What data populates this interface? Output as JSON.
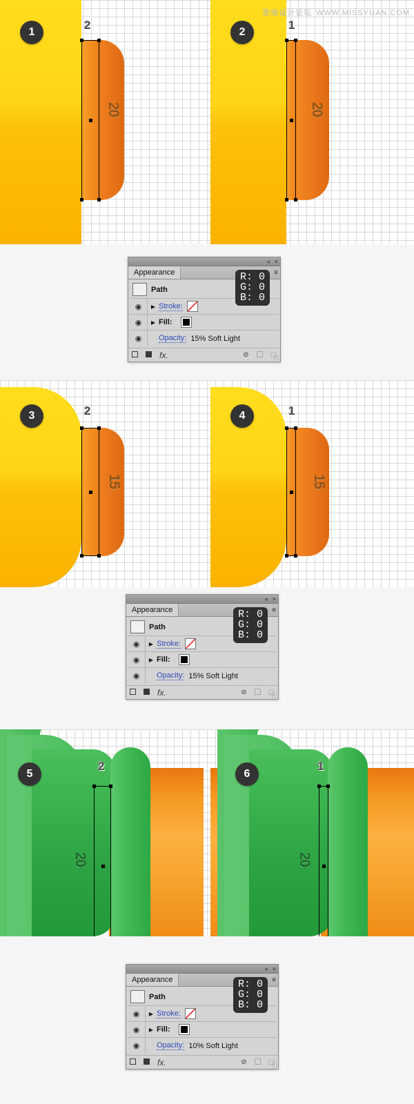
{
  "watermark": {
    "chinese": "思缘设计论坛",
    "url": "WWW.MISSYUAN.COM"
  },
  "steps": [
    {
      "badge": "1",
      "dimension": "2",
      "size": "20"
    },
    {
      "badge": "2",
      "dimension": "1",
      "size": "20"
    },
    {
      "badge": "3",
      "dimension": "2",
      "size": "15"
    },
    {
      "badge": "4",
      "dimension": "1",
      "size": "15"
    },
    {
      "badge": "5",
      "dimension": "2",
      "size": "20"
    },
    {
      "badge": "6",
      "dimension": "1",
      "size": "20"
    }
  ],
  "panels": [
    {
      "title": "Appearance",
      "collapse_icon": "«",
      "close_icon": "×",
      "menu_icon": "≡",
      "object_label": "Path",
      "stroke_label": "Stroke:",
      "fill_label": "Fill:",
      "opacity_label": "Opacity:",
      "opacity_value": "15% Soft Light",
      "tooltip": {
        "r": "R: 0",
        "g": "G: 0",
        "b": "B: 0"
      },
      "eye_icon": "◉",
      "triangle_icon": "▶",
      "footer": {
        "new_art_label": "new-art-square",
        "duplicate_label": "duplicate-square",
        "fx_label": "fx.",
        "clear_label": "⊘",
        "dup_item_label": "dup-item-square",
        "delete_label": "delete-trash"
      }
    },
    {
      "title": "Appearance",
      "collapse_icon": "«",
      "close_icon": "×",
      "menu_icon": "≡",
      "object_label": "Path",
      "stroke_label": "Stroke:",
      "fill_label": "Fill:",
      "opacity_label": "Opacity:",
      "opacity_value": "15% Soft Light",
      "tooltip": {
        "r": "R: 0",
        "g": "G: 0",
        "b": "B: 0"
      },
      "eye_icon": "◉",
      "triangle_icon": "▶",
      "footer": {
        "new_art_label": "new-art-square",
        "duplicate_label": "duplicate-square",
        "fx_label": "fx.",
        "clear_label": "⊘",
        "dup_item_label": "dup-item-square",
        "delete_label": "delete-trash"
      }
    },
    {
      "title": "Appearance",
      "collapse_icon": "«",
      "close_icon": "×",
      "menu_icon": "≡",
      "object_label": "Path",
      "stroke_label": "Stroke:",
      "fill_label": "Fill:",
      "opacity_label": "Opacity:",
      "opacity_value": "10% Soft Light",
      "tooltip": {
        "r": "R: 0",
        "g": "G: 0",
        "b": "B: 0"
      },
      "eye_icon": "◉",
      "triangle_icon": "▶",
      "footer": {
        "new_art_label": "new-art-square",
        "duplicate_label": "duplicate-square",
        "fx_label": "fx.",
        "clear_label": "⊘",
        "dup_item_label": "dup-item-square",
        "delete_label": "delete-trash"
      }
    }
  ],
  "colors": {
    "yellow_light": "#ffdd1c",
    "yellow_dark": "#f9b200",
    "orange_light": "#f7a12a",
    "orange_dark": "#dc6a12",
    "green_light": "#53c264",
    "green_dark": "#229a3a",
    "badge_bg": "#333333",
    "panel_bg": "#d4d4d4",
    "link_blue": "#2b49b8",
    "tooltip_bg": "#2f2f2f"
  }
}
